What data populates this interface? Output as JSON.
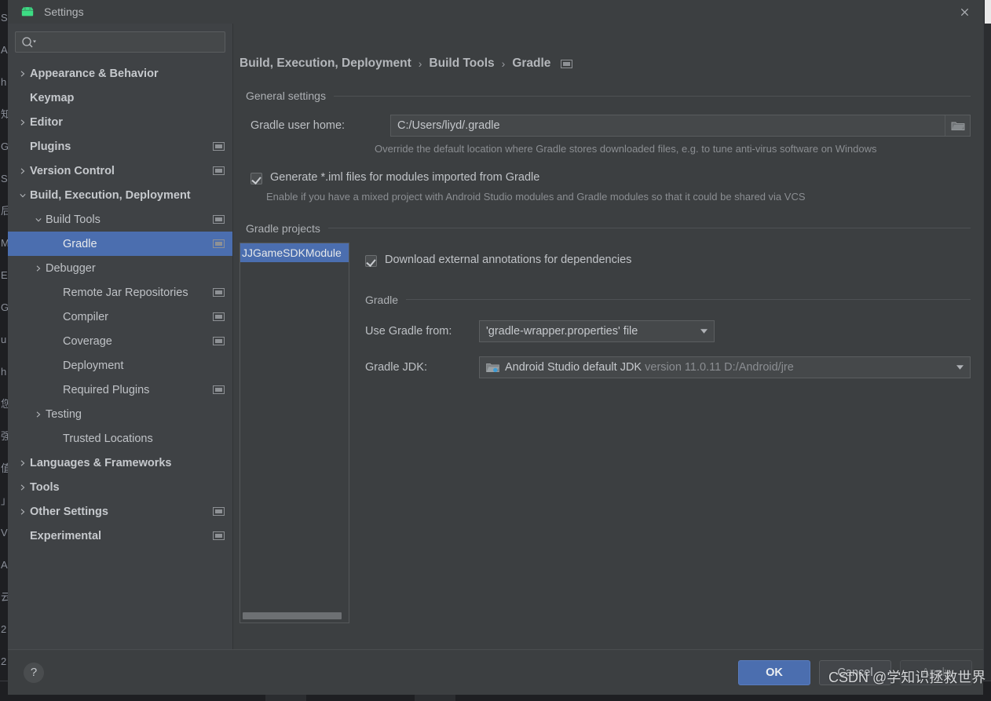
{
  "colors": {
    "accent": "#4b6eaf",
    "dialog_bg": "#3c3f41",
    "sidebar_bg": "#3f4245",
    "text": "#bfc2c6",
    "muted_text": "#8b8e92",
    "ide_bg": "#2b2d30",
    "ide_strip": "#1e1f22"
  },
  "titlebar": {
    "title": "Settings",
    "logo_icon": "android-logo-icon",
    "close_label": "✕",
    "close_icon": "close-icon"
  },
  "sidebar": {
    "search": {
      "value": "",
      "placeholder": "",
      "icon": "search-icon"
    },
    "items": [
      {
        "label": "Appearance & Behavior",
        "arrow": "right",
        "bold": true,
        "indent": 10,
        "badge": false,
        "selected": false
      },
      {
        "label": "Keymap",
        "arrow": "none",
        "bold": true,
        "indent": 10,
        "badge": false,
        "selected": false
      },
      {
        "label": "Editor",
        "arrow": "right",
        "bold": true,
        "indent": 10,
        "badge": false,
        "selected": false
      },
      {
        "label": "Plugins",
        "arrow": "none",
        "bold": true,
        "indent": 10,
        "badge": true,
        "selected": false
      },
      {
        "label": "Version Control",
        "arrow": "right",
        "bold": true,
        "indent": 10,
        "badge": true,
        "selected": false
      },
      {
        "label": "Build, Execution, Deployment",
        "arrow": "down",
        "bold": true,
        "indent": 10,
        "badge": false,
        "selected": false
      },
      {
        "label": "Build Tools",
        "arrow": "down",
        "bold": false,
        "indent": 30,
        "badge": true,
        "selected": false
      },
      {
        "label": "Gradle",
        "arrow": "none",
        "bold": false,
        "indent": 52,
        "badge": true,
        "selected": true
      },
      {
        "label": "Debugger",
        "arrow": "right",
        "bold": false,
        "indent": 30,
        "badge": false,
        "selected": false
      },
      {
        "label": "Remote Jar Repositories",
        "arrow": "none",
        "bold": false,
        "indent": 52,
        "badge": true,
        "selected": false
      },
      {
        "label": "Compiler",
        "arrow": "none",
        "bold": false,
        "indent": 52,
        "badge": true,
        "selected": false
      },
      {
        "label": "Coverage",
        "arrow": "none",
        "bold": false,
        "indent": 52,
        "badge": true,
        "selected": false
      },
      {
        "label": "Deployment",
        "arrow": "none",
        "bold": false,
        "indent": 52,
        "badge": false,
        "selected": false
      },
      {
        "label": "Required Plugins",
        "arrow": "none",
        "bold": false,
        "indent": 52,
        "badge": true,
        "selected": false
      },
      {
        "label": "Testing",
        "arrow": "right",
        "bold": false,
        "indent": 30,
        "badge": false,
        "selected": false
      },
      {
        "label": "Trusted Locations",
        "arrow": "none",
        "bold": false,
        "indent": 52,
        "badge": false,
        "selected": false
      },
      {
        "label": "Languages & Frameworks",
        "arrow": "right",
        "bold": true,
        "indent": 10,
        "badge": false,
        "selected": false
      },
      {
        "label": "Tools",
        "arrow": "right",
        "bold": true,
        "indent": 10,
        "badge": false,
        "selected": false
      },
      {
        "label": "Other Settings",
        "arrow": "right",
        "bold": true,
        "indent": 10,
        "badge": true,
        "selected": false
      },
      {
        "label": "Experimental",
        "arrow": "none",
        "bold": true,
        "indent": 10,
        "badge": true,
        "selected": false
      }
    ]
  },
  "content": {
    "breadcrumb": {
      "part1": "Build, Execution, Deployment",
      "sep1": "›",
      "part2": "Build Tools",
      "sep2": "›",
      "part3": "Gradle",
      "badge_icon": "project-scope-icon"
    },
    "general_settings": {
      "header": "General settings",
      "gradle_user_home_label": "Gradle user home:",
      "gradle_user_home_value": "C:/Users/liyd/.gradle",
      "gradle_user_home_placeholder": "",
      "browse_icon": "folder-open-icon",
      "hint": "Override the default location where Gradle stores downloaded files, e.g. to tune anti-virus software on Windows",
      "generate_iml_label": "Generate *.iml files for modules imported from Gradle",
      "generate_iml_checked": true,
      "generate_iml_hint": "Enable if you have a mixed project with Android Studio modules and Gradle modules so that it could be shared via VCS"
    },
    "gradle_projects": {
      "header": "Gradle projects",
      "list_items": [
        "JJGameSDKModule"
      ],
      "download_annotations_label": "Download external annotations for dependencies",
      "download_annotations_checked": true,
      "gradle_header": "Gradle",
      "use_gradle_from_label": "Use Gradle from:",
      "use_gradle_from_value": "'gradle-wrapper.properties' file",
      "gradle_jdk_label": "Gradle JDK:",
      "gradle_jdk_value": "Android Studio default JDK",
      "gradle_jdk_value_dim": "version 11.0.11 D:/Android/jre",
      "gradle_jdk_icon": "jdk-folder-icon",
      "dropdown_arrow_icon": "chevron-down-icon"
    }
  },
  "footer": {
    "help_label": "?",
    "help_icon": "help-icon",
    "ok_label": "OK",
    "cancel_label": "Cancel",
    "apply_label": "Apply",
    "apply_disabled": true
  },
  "watermark": {
    "text": "CSDN @学知识拯救世界"
  },
  "ide_backdrop": {
    "left_glyphs": [
      "S",
      "A",
      "h",
      "知",
      "G",
      "S",
      "后",
      "M",
      "E",
      "G",
      "u",
      "h",
      "您",
      "强",
      "值",
      "」",
      "V",
      "A",
      "云",
      "2",
      "2"
    ]
  }
}
